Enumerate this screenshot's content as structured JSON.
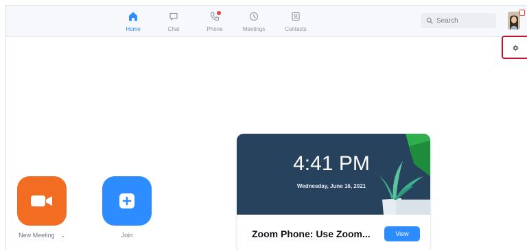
{
  "nav": {
    "tabs": [
      {
        "label": "Home",
        "icon": "home-icon",
        "active": true
      },
      {
        "label": "Chat",
        "icon": "chat-icon",
        "active": false
      },
      {
        "label": "Phone",
        "icon": "phone-icon",
        "active": false,
        "has_notification": true
      },
      {
        "label": "Meetings",
        "icon": "clock-icon",
        "active": false
      },
      {
        "label": "Contacts",
        "icon": "contacts-icon",
        "active": false
      }
    ],
    "search_placeholder": "Search"
  },
  "actions": [
    {
      "label": "New Meeting",
      "icon": "video-camera-icon",
      "color": "#f26d21",
      "has_dropdown": true
    },
    {
      "label": "Join",
      "icon": "plus-icon",
      "color": "#2d8cff",
      "has_dropdown": false
    }
  ],
  "card": {
    "time": "4:41 PM",
    "date": "Wednesday, June 16, 2021",
    "title": "Zoom Phone: Use Zoom...",
    "button_label": "View"
  },
  "colors": {
    "accent": "#2d8cff",
    "notification": "#e8443f",
    "settings_highlight": "#c8102e",
    "card_hero": "#26425c"
  }
}
